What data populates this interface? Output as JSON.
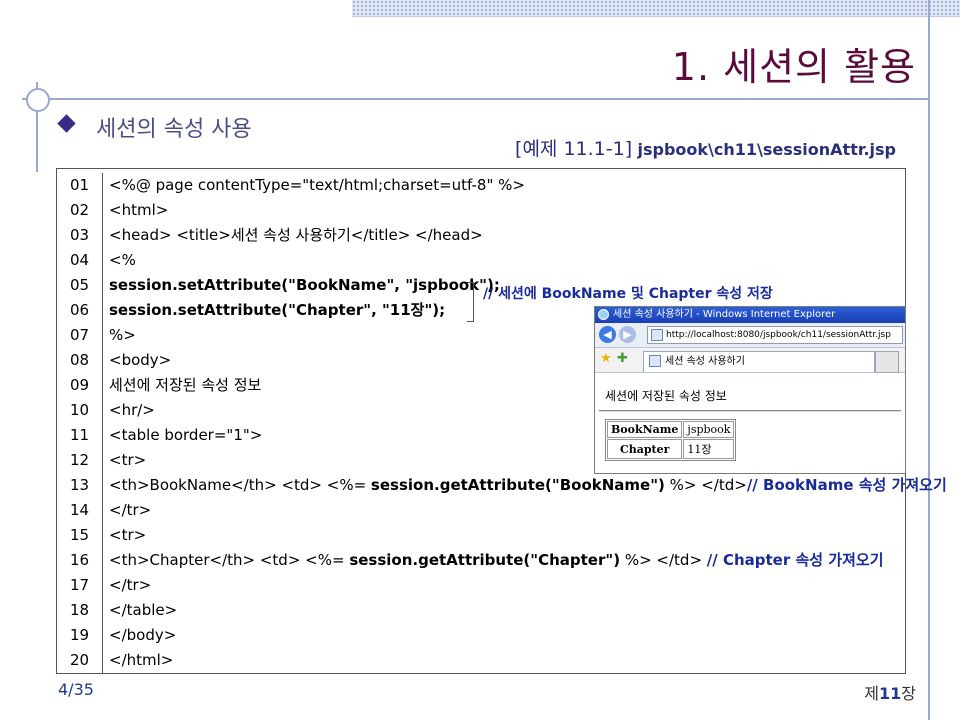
{
  "slide": {
    "title": "1. 세션의 활용",
    "subtitle": "세션의 속성 사용",
    "caption_example": "[예제 11.1-1]",
    "caption_path": "jspbook\\ch11\\sessionAttr.jsp",
    "page_number": "4/35",
    "chapter_prefix": "제",
    "chapter_num": "11",
    "chapter_suffix": "장"
  },
  "code": {
    "line_numbers": [
      "01",
      "02",
      "03",
      "04",
      "05",
      "06",
      "07",
      "08",
      "09",
      "10",
      "11",
      "12",
      "13",
      "14",
      "15",
      "16",
      "17",
      "18",
      "19",
      "20"
    ],
    "l01": "<%@ page contentType=\"text/html;charset=utf-8\" %>",
    "l02": "<html>",
    "l03": "<head> <title>세션 속성 사용하기</title> </head>",
    "l04": "<%",
    "l05": "session.setAttribute(\"BookName\", \"jspbook\");",
    "l06": "session.setAttribute(\"Chapter\", \"11장\");",
    "l07": "%>",
    "l08": "<body>",
    "l09": "세션에 저장된 속성 정보",
    "l10": "<hr/>",
    "l11": "<table border=\"1\">",
    "l12": "<tr>",
    "l13_a": "<th>BookName</th> <td> <%= ",
    "l13_b": "session.getAttribute(\"BookName\")",
    "l13_c": " %> </td>",
    "l13_comment": "// BookName 속성 가져오기",
    "l14": "</tr>",
    "l15": "<tr>",
    "l16_a": "<th>Chapter</th> <td> <%= ",
    "l16_b": "session.getAttribute(\"Chapter\")",
    "l16_c": " %> </td> ",
    "l16_comment": "// Chapter 속성 가져오기",
    "l17": "</tr>",
    "l18": "</table>",
    "l19": "</body>",
    "l20": "</html>",
    "brace_comment": "// 세션에 BookName 및 Chapter 속성 저장"
  },
  "browser": {
    "window_title": "세션 속성 사용하기 - Windows Internet Explorer",
    "address": "http://localhost:8080/jspbook/ch11/sessionAttr.jsp",
    "tab_title": "세션 속성 사용하기",
    "heading": "세션에 저장된 속성 정보",
    "table": {
      "row1_header": "BookName",
      "row1_value": "jspbook",
      "row2_header": "Chapter",
      "row2_value": "11장"
    }
  },
  "colors": {
    "title": "#5b0a3c",
    "subtitle": "#4b4e86",
    "comment": "#1a2b9a",
    "accent_lines": "#9aa8cf"
  }
}
